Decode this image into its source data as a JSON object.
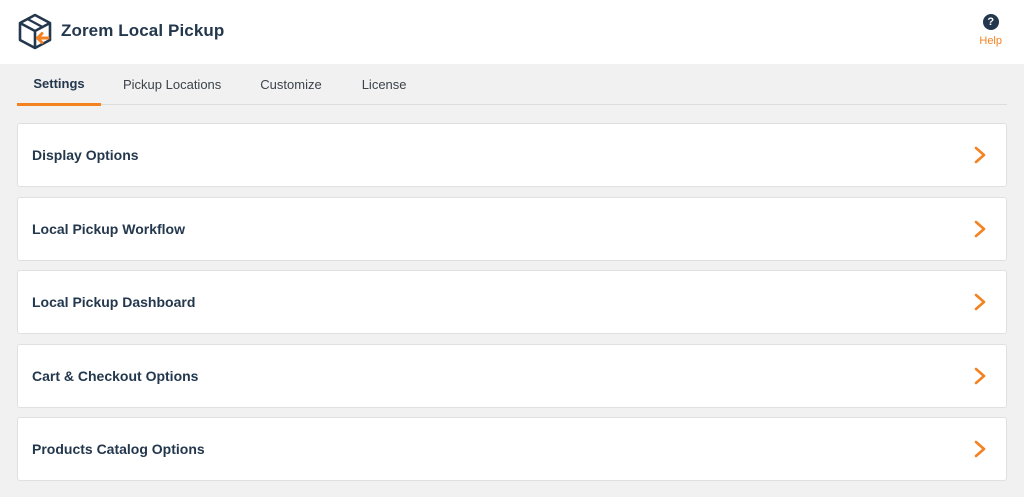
{
  "app": {
    "title": "Zorem Local Pickup",
    "logo_icon": "box-arrow-icon",
    "help_label": "Help",
    "help_icon": "question-circle-icon"
  },
  "tabs": [
    {
      "label": "Settings",
      "active": true
    },
    {
      "label": "Pickup Locations",
      "active": false
    },
    {
      "label": "Customize",
      "active": false
    },
    {
      "label": "License",
      "active": false
    }
  ],
  "sections": [
    {
      "title": "Display Options",
      "icon": "chevron-right-icon"
    },
    {
      "title": "Local Pickup Workflow",
      "icon": "chevron-right-icon"
    },
    {
      "title": "Local Pickup Dashboard",
      "icon": "chevron-right-icon"
    },
    {
      "title": "Cart & Checkout Options",
      "icon": "chevron-right-icon"
    },
    {
      "title": "Products Catalog Options",
      "icon": "chevron-right-icon"
    }
  ],
  "colors": {
    "accent": "#f58220",
    "brand_dark": "#23374d",
    "background": "#f1f1f1",
    "panel": "#ffffff"
  }
}
